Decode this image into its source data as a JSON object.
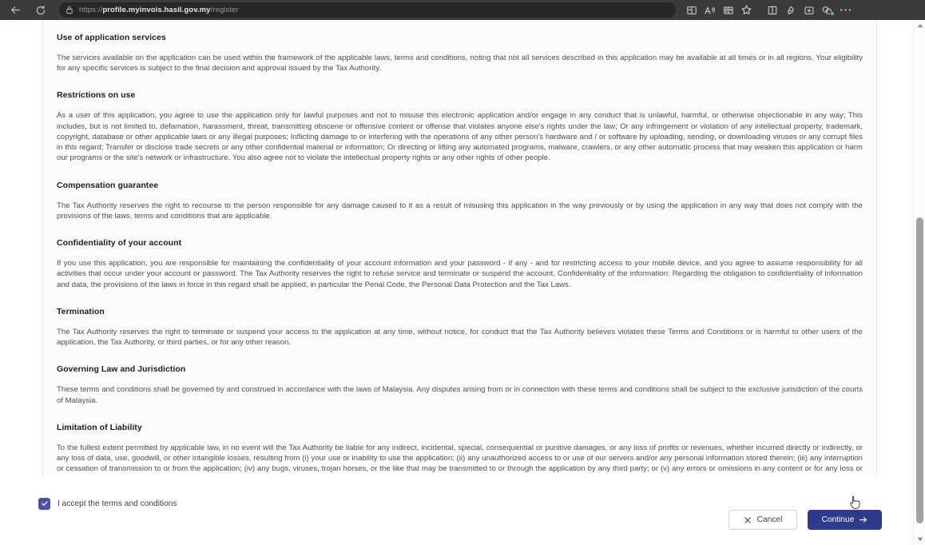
{
  "browser": {
    "back_icon": "arrow-left-icon",
    "refresh_icon": "refresh-icon",
    "lock_icon": "lock-icon",
    "url_prefix": "https://",
    "url_host": "profile.myinvois.hasil.gov.my",
    "url_path": "/register",
    "url_full": "https://profile.myinvois.hasil.gov.my/register",
    "toolbar_icons": [
      "split-screen-icon",
      "read-aloud-icon",
      "immersive-reader-icon",
      "favorites-star-icon",
      "browser-split-icon",
      "share-icon",
      "collections-icon",
      "browser-essentials-icon",
      "settings-more-icon"
    ]
  },
  "terms": {
    "sections": [
      {
        "heading": "Use of application services",
        "body": "The services available on the application can be used within the framework of the applicable laws, terms and conditions, noting that not all services described in this application may be available at all times or in all regions. Your eligibility for any specific services is subject to the final decision and approval issued by the Tax Authority."
      },
      {
        "heading": "Restrictions on use",
        "body": "As a user of this application, you agree to use the application only for lawful purposes and not to misuse this electronic application and/or engage in any conduct that is unlawful, harmful, or otherwise objectionable in any way; This includes, but is not limited to, defamation, harassment, threat, transmitting obscene or offensive content or offense that violates anyone else's rights under the law; Or any infringement or violation of any intellectual property, trademark, copyright, database or other applicable laws or any illegal purposes; Inflicting damage to or interfering with the operations of any other person's hardware and / or software by uploading, sending, or downloading viruses or any corrupt files in this regard; Transfer or disclose trade secrets or any other confidential material or information; Or directing or lifting any automated programs, malware, crawlers, or any other automatic process that may weaken this application or harm our programs or the site's network or infrastructure. You also agree not to violate the intellectual property rights or any other rights of other people."
      },
      {
        "heading": "Compensation guarantee",
        "body": "The Tax Authority reserves the right to recourse to the person responsible for any damage caused to it as a result of misusing this application in the way previously or by using the application in any way that does not comply with the provisions of the laws, terms and conditions that are applicable."
      },
      {
        "heading": "Confidentiality of your account",
        "body": "If you use this application, you are responsible for maintaining the confidentiality of your account information and your password - if any - and for restricting access to your mobile device, and you agree to assume responsibility for all activities that occur under your account or password. The Tax Authority reserves the right to refuse service and terminate or suspend the account. Confidentiality of the information: Regarding the obligation to confidentiality of information and data, the provisions of the laws in force in this regard shall be applied, in particular the Penal Code, the Personal Data Protection and the Tax Laws."
      },
      {
        "heading": "Termination",
        "body": "The Tax Authority reserves the right to terminate or suspend your access to the application at any time, without notice, for conduct that the Tax Authority believes violates these Terms and Conditions or is harmful to other users of the application, the Tax Authority, or third parties, or for any other reason."
      },
      {
        "heading": "Governing Law and Jurisdiction",
        "body": "These terms and conditions shall be governed by and construed in accordance with the laws of Malaysia. Any disputes arising from or in connection with these terms and conditions shall be subject to the exclusive jurisdiction of the courts of Malaysia."
      },
      {
        "heading": "Limitation of Liability",
        "body": "To the fullest extent permitted by applicable law, in no event will the Tax Authority be liable for any indirect, incidental, special, consequential or punitive damages, or any loss of profits or revenues, whether incurred directly or indirectly, or any loss of data, use, goodwill, or other intangible losses, resulting from (i) your use or inability to use the application; (ii) any unauthorized access to or use of our servers and/or any personal information stored therein; (iii) any interruption or cessation of transmission to or from the application; (iv) any bugs, viruses, trojan horses, or the like that may be transmitted to or through the application by any third party; or (v) any errors or omissions in any content or for any loss or damage incurred as a result of the use of any content posted, emailed, transmitted, or otherwise made available through the application, whether based on warranty, contract, tort (including negligence), or any other legal theory, and whether or not the Tax Authority has been informed of the possibility of such damages."
      }
    ]
  },
  "footer": {
    "accept_label": "I accept the terms and conditions",
    "accept_checked": true,
    "check_icon": "checkmark-icon",
    "cancel_label": "Cancel",
    "cancel_icon": "close-x-icon",
    "continue_label": "Continue",
    "continue_icon": "arrow-right-icon"
  },
  "colors": {
    "accent": "#2e3a8c",
    "checkbox": "#4c4fad",
    "chrome": "#3b3b3b",
    "addressbar": "#262626",
    "card_bg": "#fcfcfc",
    "card_border": "#e6e6e6",
    "scroll_thumb": "#a0a0a6"
  }
}
